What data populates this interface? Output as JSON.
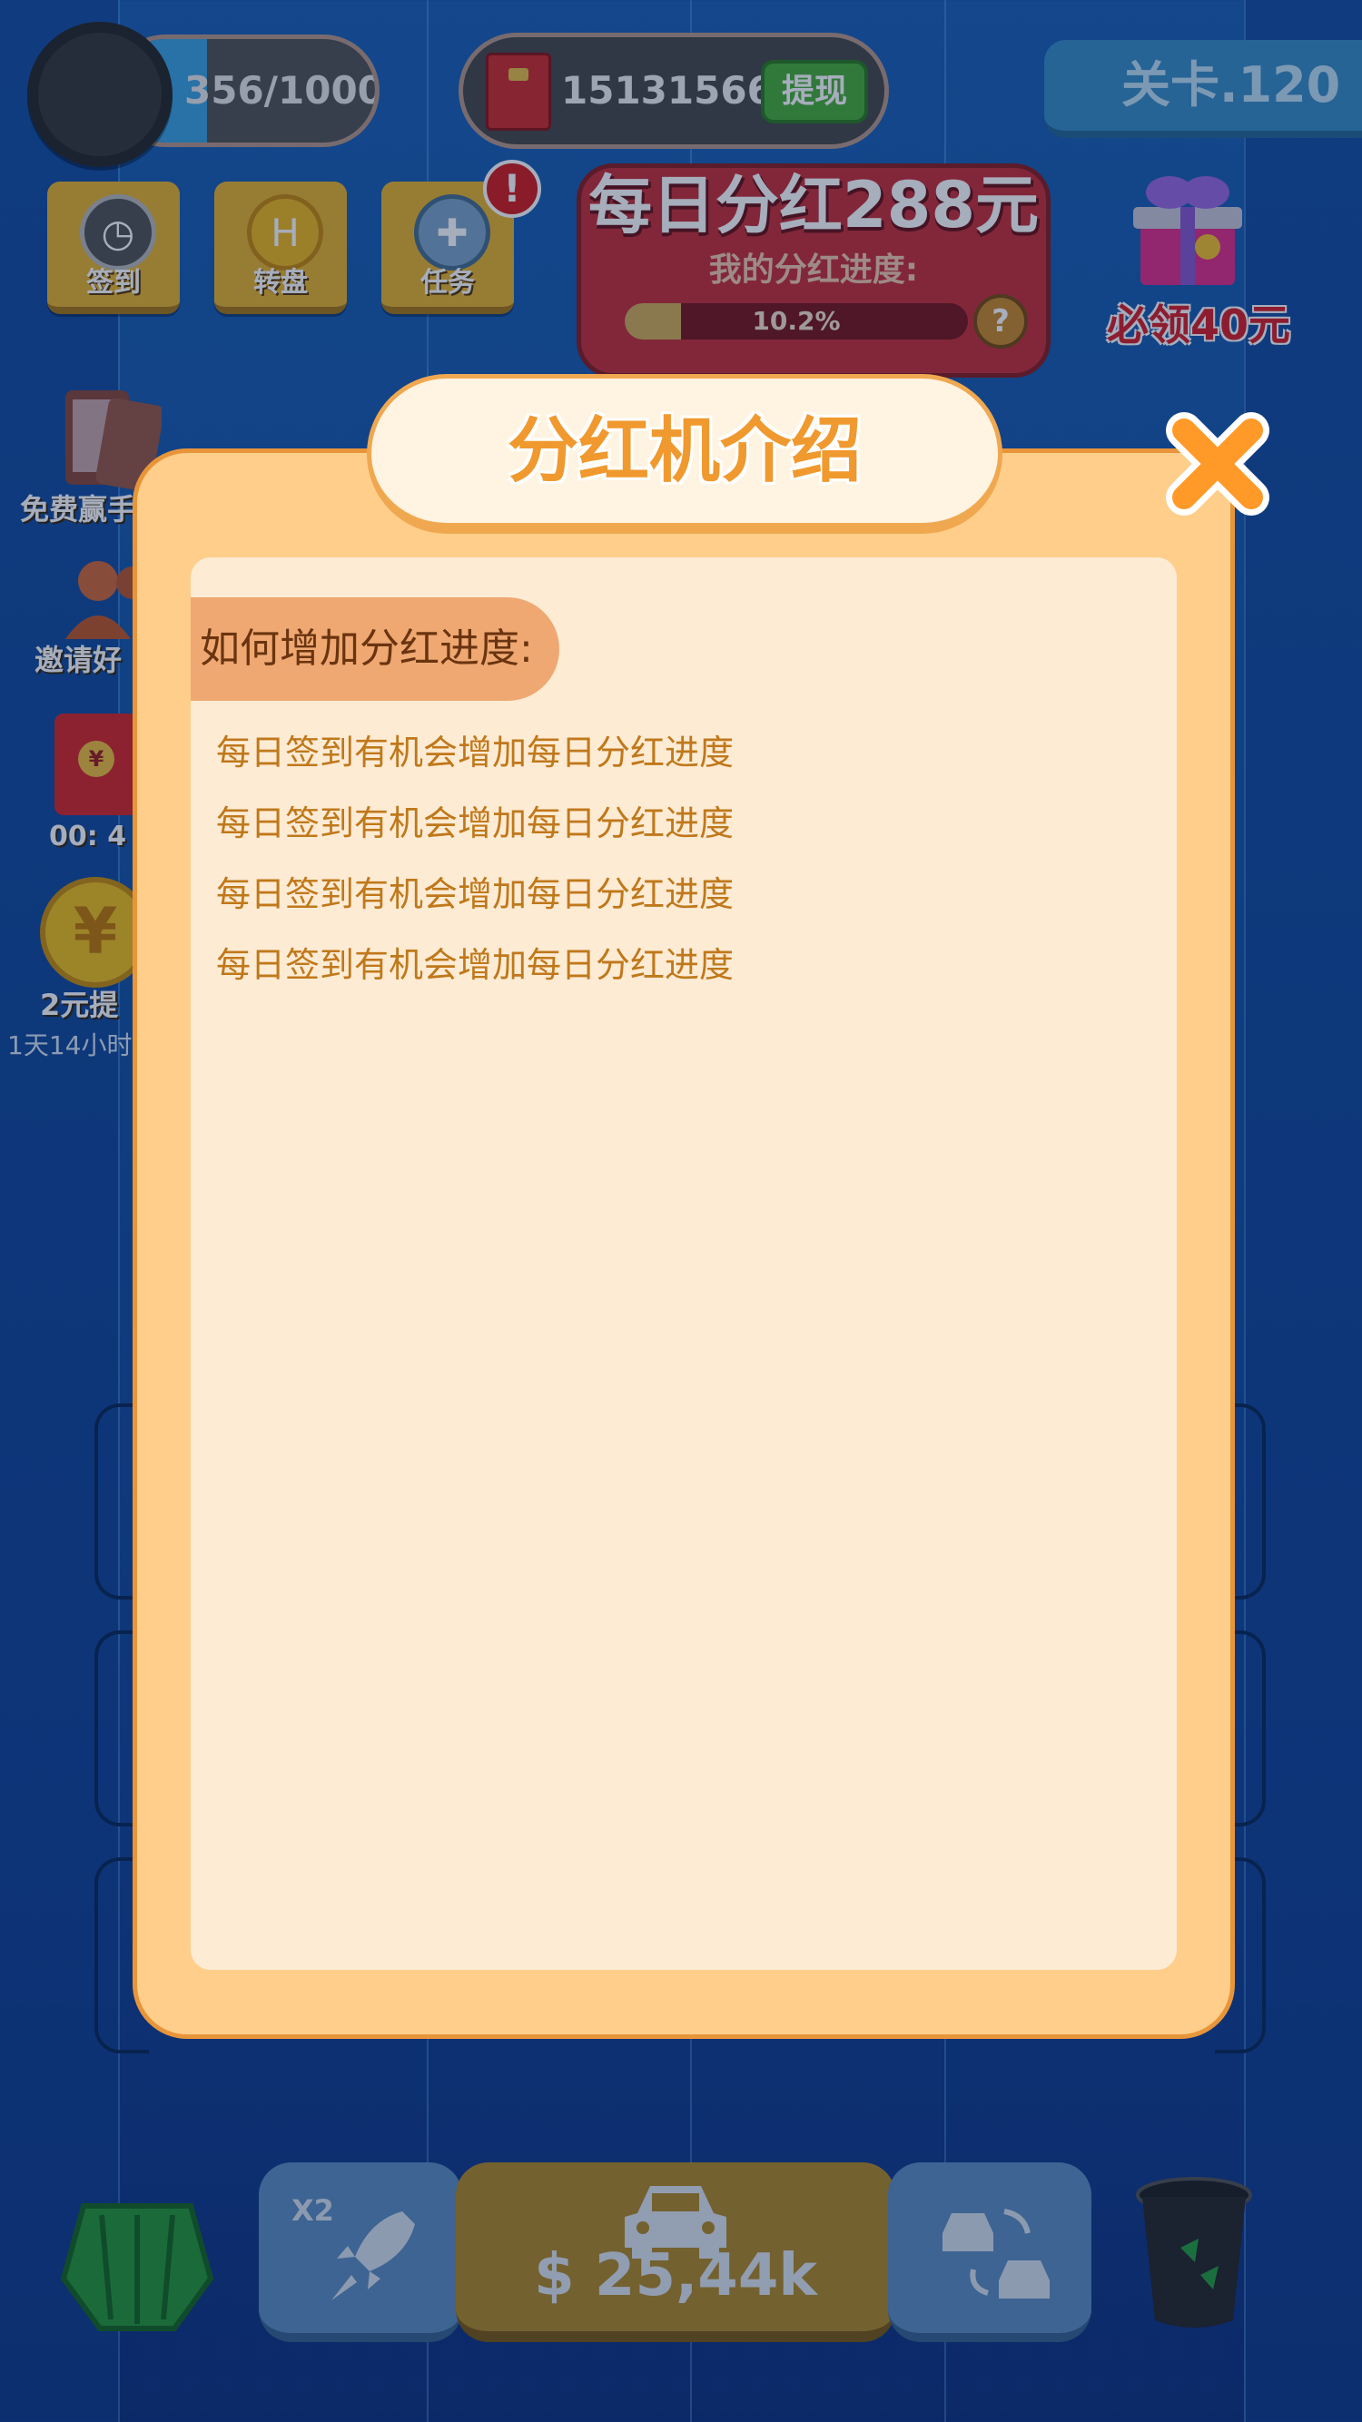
{
  "header": {
    "exp_text": "356/1000",
    "exp_progress": 0.356,
    "cash_amount": "15131566",
    "withdraw_label": "提现",
    "level_label": "关卡.120"
  },
  "features": [
    {
      "label": "签到",
      "icon": "calendar-clock-icon"
    },
    {
      "label": "转盘",
      "icon": "wheel-coin-icon"
    },
    {
      "label": "任务",
      "icon": "task-clock-icon"
    }
  ],
  "alert_badge": "!",
  "dividend": {
    "title": "每日分红288元",
    "subtitle": "我的分红进度:",
    "progress_text": "10.2%",
    "progress_value": 0.102,
    "help_label": "?"
  },
  "gift": {
    "label": "必领40元",
    "icon": "gift-box-icon"
  },
  "side_items": [
    {
      "label": "免费赢手",
      "icon": "phone-icon"
    },
    {
      "label": "邀请好",
      "icon": "invite-friends-icon"
    },
    {
      "label": "00: 4",
      "icon": "red-envelope-icon"
    },
    {
      "label": "2元提",
      "icon": "yuan-coin-icon"
    },
    {
      "label": "1天14小时",
      "icon": ""
    }
  ],
  "bottom": {
    "boost_badge": "X2",
    "buy_price": "$ 25,44k"
  },
  "modal": {
    "title": "分红机介绍",
    "section_heading": "如何增加分红进度:",
    "tips": [
      "每日签到有机会增加每日分红进度",
      "每日签到有机会增加每日分红进度",
      "每日签到有机会增加每日分红进度",
      "每日签到有机会增加每日分红进度"
    ]
  },
  "colors": {
    "modal_bg": "#ffce8a",
    "content_bg": "#fdebd4",
    "title_orange": "#f0992e",
    "tip_text": "#c0781a",
    "dividend_red": "#c8323a"
  }
}
